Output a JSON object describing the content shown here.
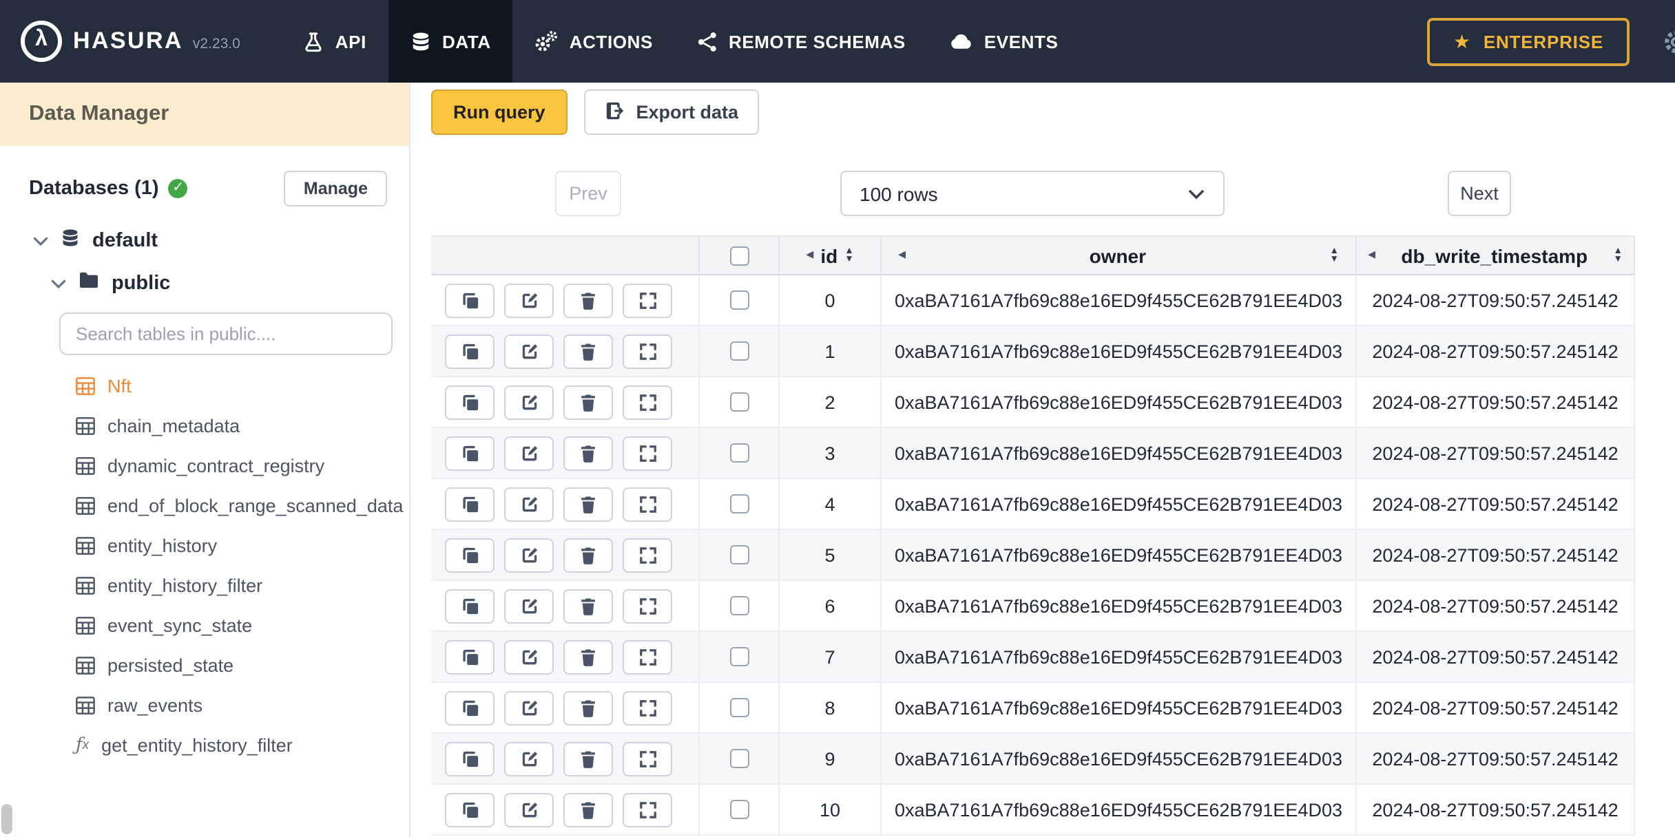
{
  "navbar": {
    "brand": "HASURA",
    "version": "v2.23.0",
    "items": [
      {
        "label": "API",
        "icon": "flask-icon",
        "active": false
      },
      {
        "label": "DATA",
        "icon": "database-icon",
        "active": true
      },
      {
        "label": "ACTIONS",
        "icon": "gears-icon",
        "active": false
      },
      {
        "label": "REMOTE SCHEMAS",
        "icon": "share-icon",
        "active": false
      },
      {
        "label": "EVENTS",
        "icon": "cloud-icon",
        "active": false
      }
    ],
    "enterprise_label": "ENTERPRISE"
  },
  "sidebar": {
    "title": "Data Manager",
    "databases_label": "Databases (1)",
    "manage_label": "Manage",
    "database_name": "default",
    "schema_name": "public",
    "search_placeholder": "Search tables in public....",
    "tables": [
      {
        "label": "Nft",
        "active": true
      },
      {
        "label": "chain_metadata",
        "active": false
      },
      {
        "label": "dynamic_contract_registry",
        "active": false
      },
      {
        "label": "end_of_block_range_scanned_data",
        "active": false
      },
      {
        "label": "entity_history",
        "active": false
      },
      {
        "label": "entity_history_filter",
        "active": false
      },
      {
        "label": "event_sync_state",
        "active": false
      },
      {
        "label": "persisted_state",
        "active": false
      },
      {
        "label": "raw_events",
        "active": false
      }
    ],
    "function_name": "get_entity_history_filter"
  },
  "toolbar": {
    "run_query_label": "Run query",
    "export_data_label": "Export data"
  },
  "pagination": {
    "prev_label": "Prev",
    "rows_label": "100 rows",
    "next_label": "Next"
  },
  "table": {
    "columns": [
      "id",
      "owner",
      "db_write_timestamp"
    ],
    "rows": [
      {
        "id": "0",
        "owner": "0xaBA7161A7fb69c88e16ED9f455CE62B791EE4D03",
        "db_write_timestamp": "2024-08-27T09:50:57.245142"
      },
      {
        "id": "1",
        "owner": "0xaBA7161A7fb69c88e16ED9f455CE62B791EE4D03",
        "db_write_timestamp": "2024-08-27T09:50:57.245142"
      },
      {
        "id": "2",
        "owner": "0xaBA7161A7fb69c88e16ED9f455CE62B791EE4D03",
        "db_write_timestamp": "2024-08-27T09:50:57.245142"
      },
      {
        "id": "3",
        "owner": "0xaBA7161A7fb69c88e16ED9f455CE62B791EE4D03",
        "db_write_timestamp": "2024-08-27T09:50:57.245142"
      },
      {
        "id": "4",
        "owner": "0xaBA7161A7fb69c88e16ED9f455CE62B791EE4D03",
        "db_write_timestamp": "2024-08-27T09:50:57.245142"
      },
      {
        "id": "5",
        "owner": "0xaBA7161A7fb69c88e16ED9f455CE62B791EE4D03",
        "db_write_timestamp": "2024-08-27T09:50:57.245142"
      },
      {
        "id": "6",
        "owner": "0xaBA7161A7fb69c88e16ED9f455CE62B791EE4D03",
        "db_write_timestamp": "2024-08-27T09:50:57.245142"
      },
      {
        "id": "7",
        "owner": "0xaBA7161A7fb69c88e16ED9f455CE62B791EE4D03",
        "db_write_timestamp": "2024-08-27T09:50:57.245142"
      },
      {
        "id": "8",
        "owner": "0xaBA7161A7fb69c88e16ED9f455CE62B791EE4D03",
        "db_write_timestamp": "2024-08-27T09:50:57.245142"
      },
      {
        "id": "9",
        "owner": "0xaBA7161A7fb69c88e16ED9f455CE62B791EE4D03",
        "db_write_timestamp": "2024-08-27T09:50:57.245142"
      },
      {
        "id": "10",
        "owner": "0xaBA7161A7fb69c88e16ED9f455CE62B791EE4D03",
        "db_write_timestamp": "2024-08-27T09:50:57.245142"
      }
    ]
  }
}
